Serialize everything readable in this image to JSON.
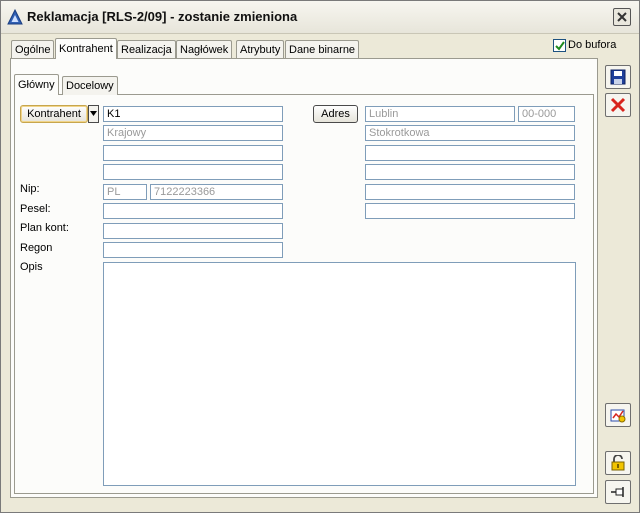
{
  "window": {
    "title": "Reklamacja  [RLS-2/09] - zostanie zmieniona"
  },
  "tabs": [
    "Ogólne",
    "Kontrahent",
    "Realizacja",
    "Nagłówek",
    "Atrybuty",
    "Dane binarne"
  ],
  "active_tab": "Kontrahent",
  "subtabs": [
    "Główny",
    "Docelowy"
  ],
  "active_subtab": "Główny",
  "do_bufora": {
    "label": "Do bufora",
    "checked": true
  },
  "buttons": {
    "kontrahent": "Kontrahent",
    "adres": "Adres"
  },
  "left_fields": {
    "akronim": "K1",
    "typ": "Krajowy",
    "line3": "",
    "line4": "",
    "nip_prefix": "PL",
    "nip": "7122223366",
    "pesel": "",
    "plan_kont": "",
    "regon": ""
  },
  "labels": {
    "nip": "Nip:",
    "pesel": "Pesel:",
    "plan_kont": "Plan kont:",
    "regon": "Regon",
    "opis": "Opis"
  },
  "address": {
    "miasto": "Lublin",
    "kod": "00-000",
    "ulica": "Stokrotkowa",
    "line3": "",
    "line4": "",
    "line5": "",
    "line6": ""
  },
  "opis": "",
  "side_icons": [
    "save-icon",
    "cancel-icon",
    "history-icon",
    "unlock-icon",
    "pin-icon"
  ],
  "colors": {
    "cancel_red": "#d8241c",
    "save_blue": "#1f3f9a",
    "field_border": "#7f9db9"
  }
}
